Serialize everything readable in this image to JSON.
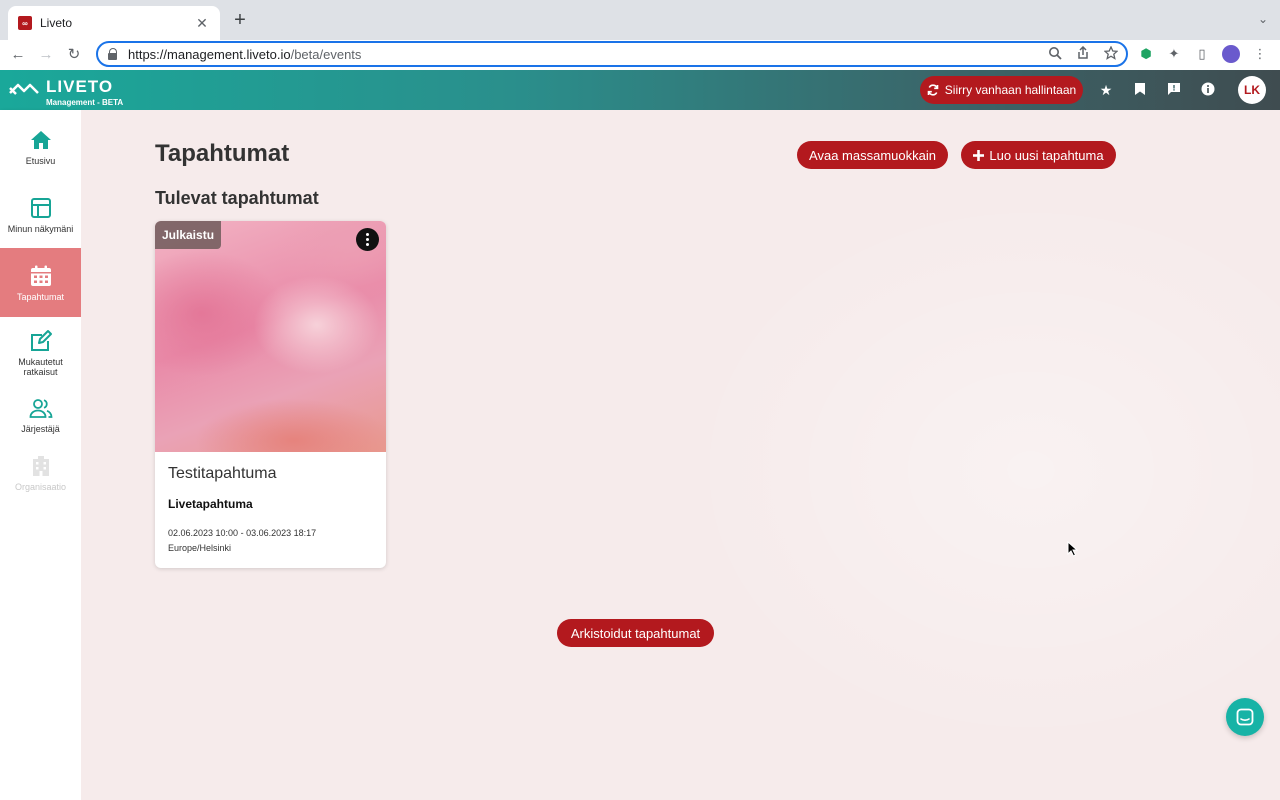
{
  "browser": {
    "tab_title": "Liveto",
    "tab_close": "✕",
    "new_tab": "+",
    "tab_menu": "⌄",
    "url_host": "https://management.liveto.io",
    "url_path": "/beta/events"
  },
  "header": {
    "logo_text": "LIVETO",
    "logo_sub": "Management - BETA",
    "old_admin_button": "Siirry vanhaan hallintaan",
    "user_initials": "LK"
  },
  "sidebar": {
    "items": [
      {
        "label": "Etusivu",
        "icon": "home-icon"
      },
      {
        "label": "Minun näkymäni",
        "icon": "layout-icon"
      },
      {
        "label": "Tapahtumat",
        "icon": "calendar-icon"
      },
      {
        "label": "Mukautetut ratkaisut",
        "icon": "edit-icon"
      },
      {
        "label": "Järjestäjä",
        "icon": "users-icon"
      },
      {
        "label": "Organisaatio",
        "icon": "building-icon"
      }
    ]
  },
  "main": {
    "title": "Tapahtumat",
    "mass_edit_button": "Avaa massamuokkain",
    "create_button": "Luo uusi tapahtuma",
    "section_title": "Tulevat tapahtumat",
    "archived_button": "Arkistoidut tapahtumat"
  },
  "event_card": {
    "status": "Julkaistu",
    "title": "Testitapahtuma",
    "type": "Livetapahtuma",
    "dates": "02.06.2023 10:00 - 03.06.2023 18:17",
    "timezone": "Europe/Helsinki"
  },
  "colors": {
    "brand_red": "#b3191e",
    "brand_teal": "#1aa89a",
    "active_nav": "#e47c7f"
  }
}
